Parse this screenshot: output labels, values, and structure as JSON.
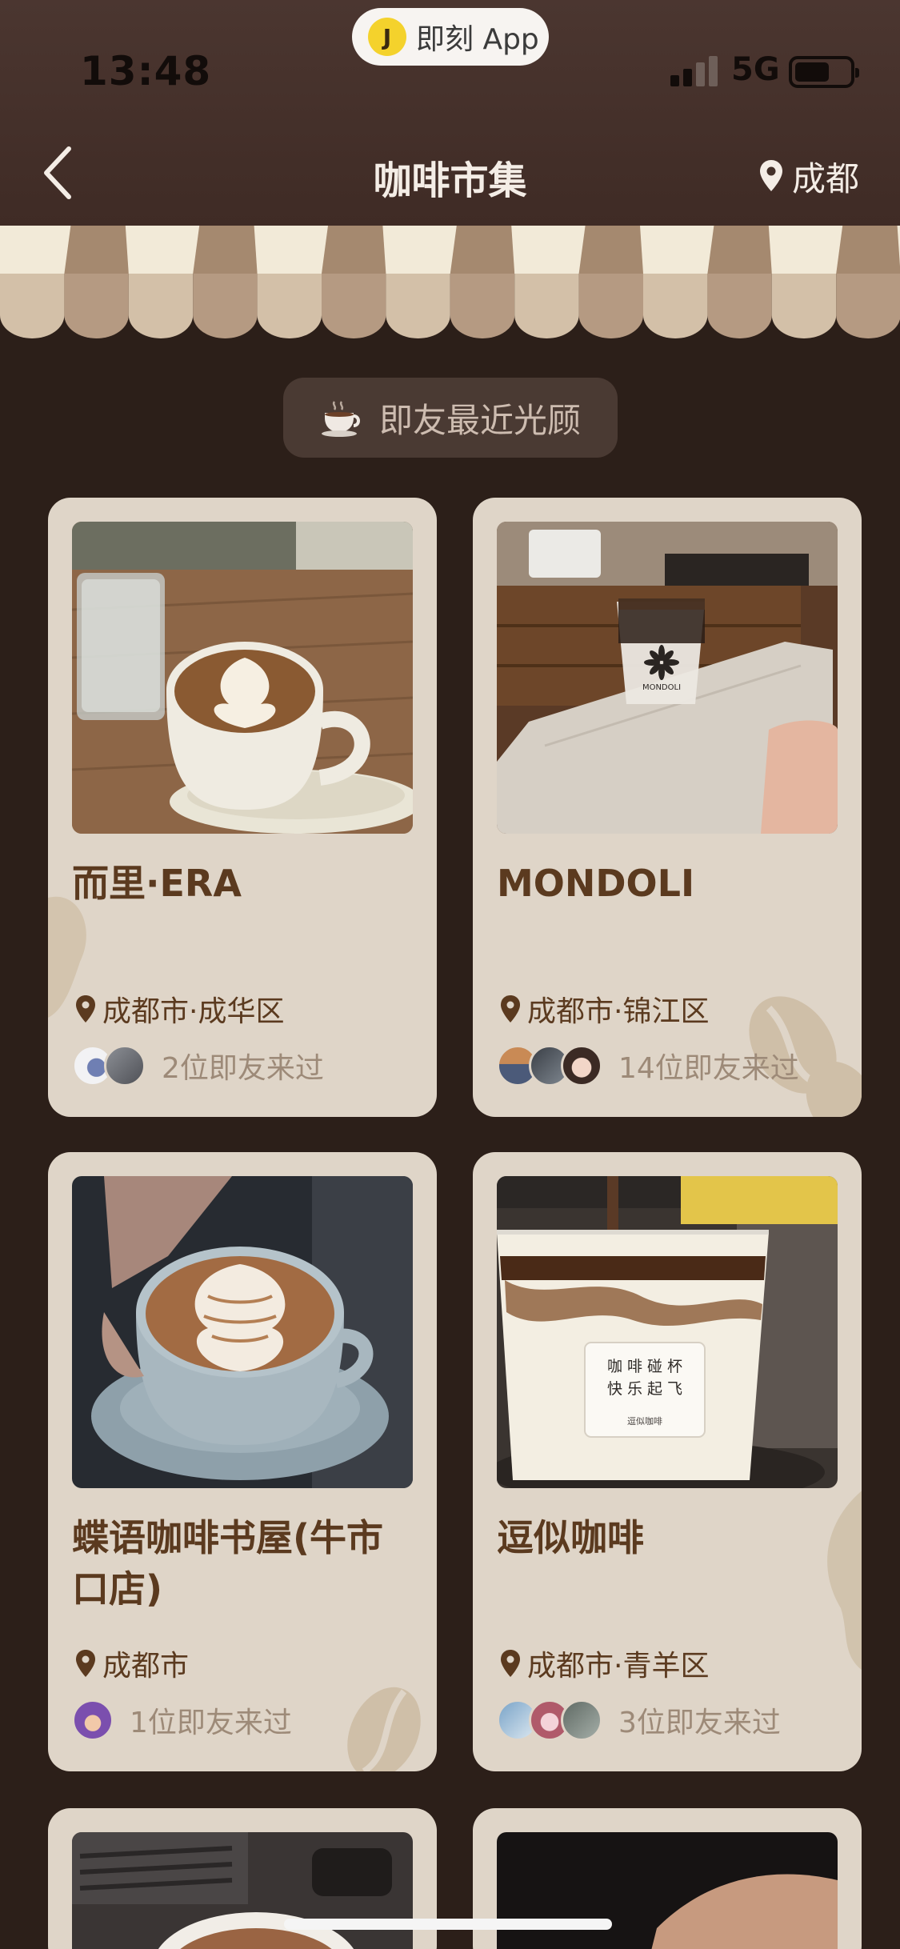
{
  "status_bar": {
    "time": "13:48",
    "network": "5G",
    "battery_level": 0.55,
    "signal_bars": 2
  },
  "app_pill": {
    "badge_glyph": "J",
    "label": "即刻 App"
  },
  "nav": {
    "title": "咖啡市集",
    "city": "成都",
    "back_icon": "chevron-left-icon",
    "location_icon": "pin-icon"
  },
  "chip": {
    "icon": "coffee-cup-icon",
    "label": "即友最近光顾"
  },
  "cafes": [
    {
      "name": "而里·ERA",
      "location": "成都市·成华区",
      "friends_text": "2位即友来过",
      "avatar_count": 2
    },
    {
      "name": "MONDOLI",
      "location": "成都市·锦江区",
      "friends_text": "14位即友来过",
      "avatar_count": 3
    },
    {
      "name": "蝶语咖啡书屋(牛市口店)",
      "location": "成都市",
      "friends_text": "1位即友来过",
      "avatar_count": 1
    },
    {
      "name": "逗似咖啡",
      "location": "成都市·青羊区",
      "friends_text": "3位即友来过",
      "avatar_count": 3
    }
  ],
  "cup_text": {
    "line1": "咖 啡 碰 杯",
    "line2": "快 乐 起 飞",
    "brand": "逗似咖啡",
    "mondoli_logo": "MONDOLI"
  },
  "colors": {
    "card_bg": "#dfd5c8",
    "page_bg": "#2c1f19",
    "accent_brown": "#5b3a1f",
    "muted_text": "#9d8a78"
  }
}
